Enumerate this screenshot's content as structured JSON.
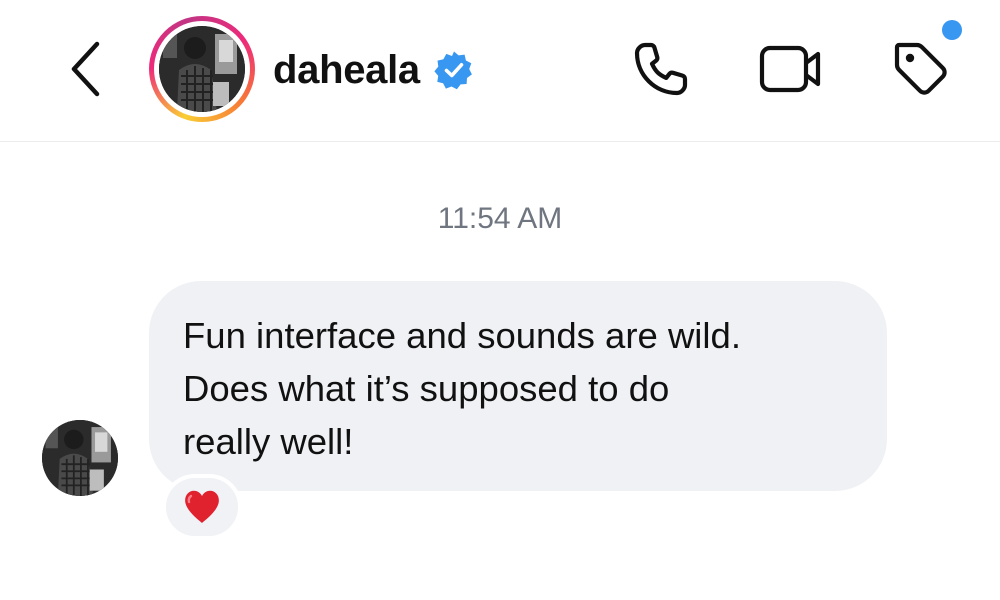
{
  "header": {
    "username": "daheala",
    "verified": true,
    "icons": {
      "back": "chevron-left-icon",
      "phone": "phone-icon",
      "video": "video-camera-icon",
      "tag": "tag-icon"
    },
    "notification_dot_color": "#3897f0",
    "story_ring": true
  },
  "conversation": {
    "timestamp": "11:54 AM",
    "messages": [
      {
        "sender": "daheala",
        "lines": [
          "Fun interface and sounds are wild.",
          "Does what it’s supposed to do",
          "really well!"
        ],
        "reaction": "red-heart-icon"
      }
    ]
  },
  "colors": {
    "bubble": "#eff1f4",
    "text": "#111111",
    "timestamp": "#6f7680",
    "verified_badge": "#3897f0",
    "heart": "#e0222f"
  }
}
